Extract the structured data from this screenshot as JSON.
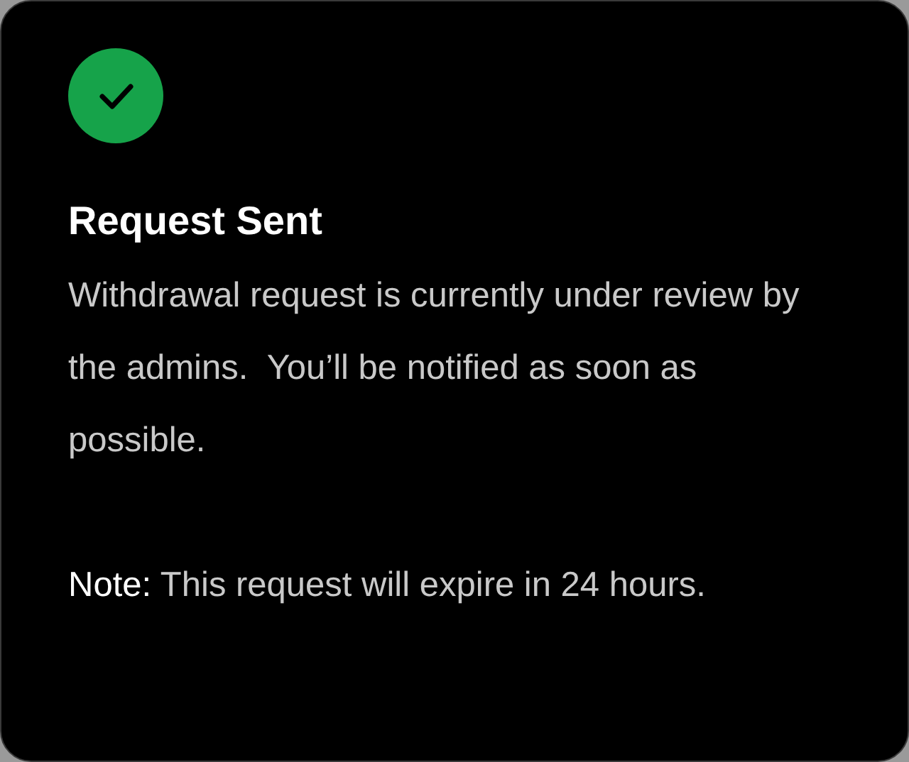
{
  "status": {
    "kind": "success"
  },
  "title": "Request Sent",
  "message": "Withdrawal request is currently under review by the admins.  You’ll be notified as soon as possible.",
  "note": "**Note:** This request will expire in 24 hours."
}
